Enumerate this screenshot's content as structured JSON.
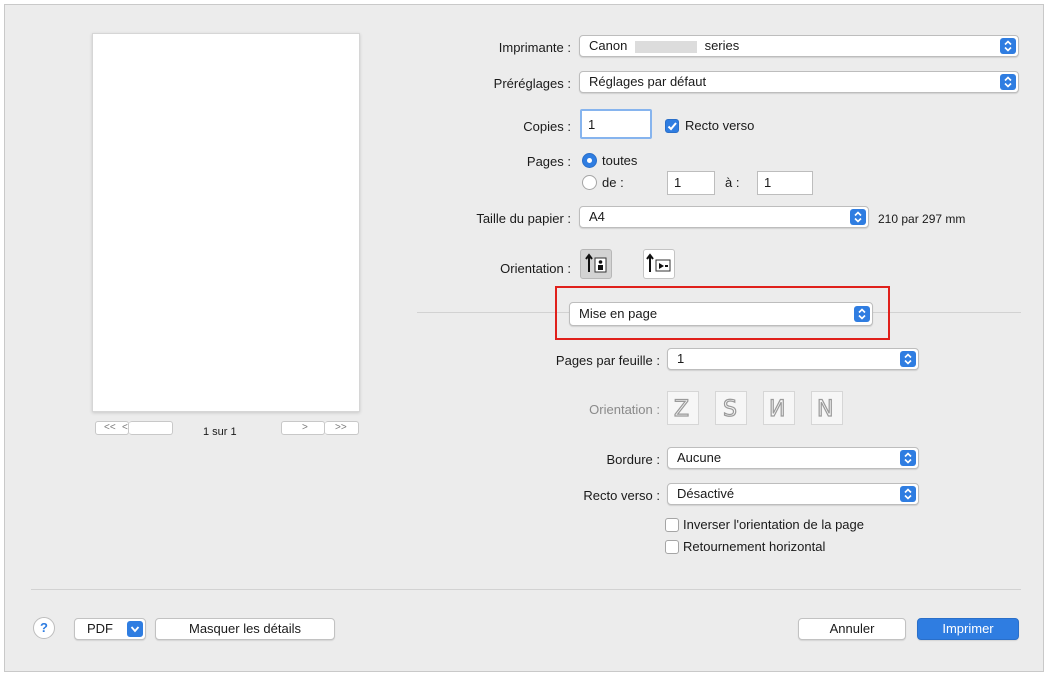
{
  "preview": {
    "page_indicator": "1 sur 1",
    "first_label": "<<",
    "prev_label": "<",
    "next_label": ">",
    "last_label": ">>"
  },
  "printer": {
    "label": "Imprimante :",
    "value_left": "Canon",
    "value_right": "series"
  },
  "presets": {
    "label": "Préréglages :",
    "value": "Réglages par défaut"
  },
  "copies": {
    "label": "Copies :",
    "value": "1",
    "duplex_label": "Recto verso",
    "duplex_checked": true
  },
  "pages": {
    "label": "Pages :",
    "all_label": "toutes",
    "range_label": "de :",
    "from_value": "1",
    "to_label": "à :",
    "to_value": "1",
    "selected": "toutes"
  },
  "paper_size": {
    "label": "Taille du papier :",
    "value": "A4",
    "dimensions": "210 par 297 mm"
  },
  "orientation": {
    "label": "Orientation :",
    "selected": "portrait"
  },
  "section_menu": {
    "value": "Mise en page"
  },
  "layout": {
    "pages_per_sheet_label": "Pages par feuille :",
    "pages_per_sheet_value": "1",
    "direction_label": "Orientation :",
    "border_label": "Bordure :",
    "border_value": "Aucune",
    "two_sided_label": "Recto verso :",
    "two_sided_value": "Désactivé",
    "reverse_label": "Inverser l'orientation de la page",
    "reverse_checked": false,
    "flip_label": "Retournement horizontal",
    "flip_checked": false
  },
  "footer": {
    "help_label": "?",
    "pdf_label": "PDF",
    "hide_details_label": "Masquer les détails",
    "cancel_label": "Annuler",
    "print_label": "Imprimer"
  },
  "colors": {
    "accent": "#2f7de1",
    "highlight": "#e0201b",
    "background": "#ececec"
  }
}
